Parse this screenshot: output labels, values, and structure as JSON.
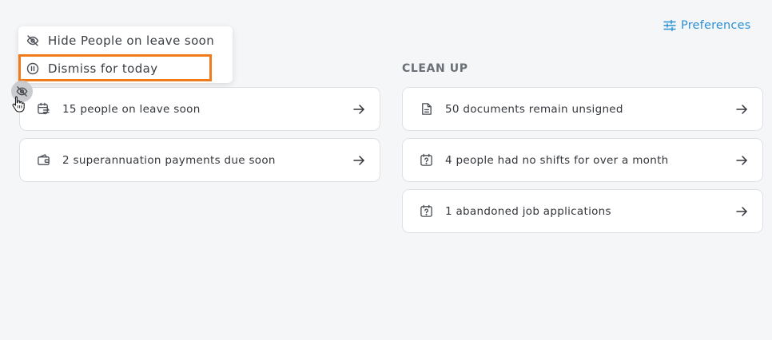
{
  "header": {
    "preferences_label": "Preferences",
    "preferences_icon": "sliders-icon"
  },
  "context_menu": {
    "items": [
      {
        "label": "Hide People on leave soon",
        "icon": "eye-off-icon"
      },
      {
        "label": "Dismiss for today",
        "icon": "pause-circle-icon"
      }
    ]
  },
  "left_cards": [
    {
      "label": "15 people on leave soon",
      "icon": "calendar-transfer-icon"
    },
    {
      "label": "2 superannuation payments due soon",
      "icon": "wallet-icon"
    }
  ],
  "cleanup": {
    "title": "CLEAN UP",
    "cards": [
      {
        "label": "50 documents remain unsigned",
        "icon": "document-icon"
      },
      {
        "label": "4 people had no shifts for over a month",
        "icon": "calendar-question-icon"
      },
      {
        "label": "1 abandoned job applications",
        "icon": "calendar-question-icon"
      }
    ]
  },
  "colors": {
    "accent": "#2a8fd4",
    "highlight": "#ef7b1d",
    "background": "#f5f6f8"
  }
}
